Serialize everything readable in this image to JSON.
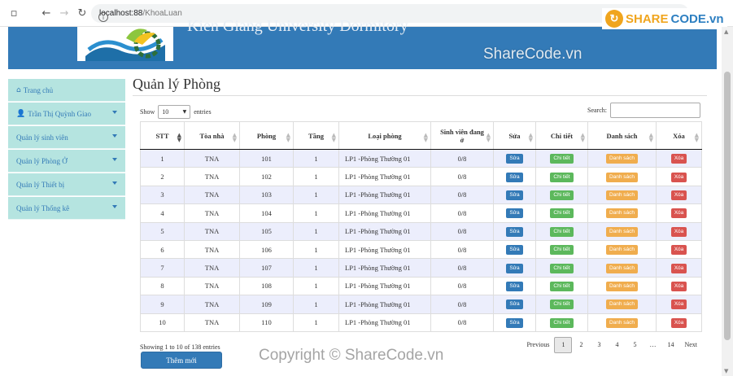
{
  "browser": {
    "url_host": "localhost:88",
    "url_path": "/KhoaLuan"
  },
  "header": {
    "title": "Kien Giang University Dormitory"
  },
  "watermarks": {
    "brand_share": "SHARE",
    "brand_code": "CODE.vn",
    "top": "ShareCode.vn",
    "bottom": "Copyright © ShareCode.vn"
  },
  "sidebar": {
    "items": [
      {
        "label": "Trang chủ",
        "icon": "home-icon",
        "has_caret": false
      },
      {
        "label": "Trần Thị Quỳnh Giao",
        "icon": "user-icon",
        "has_caret": true
      },
      {
        "label": "Quản lý sinh viên",
        "has_caret": true
      },
      {
        "label": "Quản lý Phòng Ở",
        "has_caret": true
      },
      {
        "label": "Quản lý Thiết bị",
        "has_caret": true
      },
      {
        "label": "Quản lý Thống kê",
        "has_caret": true
      }
    ]
  },
  "main": {
    "title": "Quản lý Phòng",
    "show_label": "Show",
    "entries_value": "10",
    "entries_label": "entries",
    "search_label": "Search:",
    "columns": [
      "STT",
      "Tòa nhà",
      "Phòng",
      "Tầng",
      "Loại phòng",
      "Sinh viên đang ở",
      "Sửa",
      "Chi tiết",
      "Danh sách",
      "Xóa"
    ],
    "rows": [
      {
        "stt": "1",
        "building": "TNA",
        "room": "101",
        "floor": "1",
        "type": "LP1 -Phòng Thường 01",
        "students": "0/8"
      },
      {
        "stt": "2",
        "building": "TNA",
        "room": "102",
        "floor": "1",
        "type": "LP1 -Phòng Thường 01",
        "students": "0/8"
      },
      {
        "stt": "3",
        "building": "TNA",
        "room": "103",
        "floor": "1",
        "type": "LP1 -Phòng Thường 01",
        "students": "0/8"
      },
      {
        "stt": "4",
        "building": "TNA",
        "room": "104",
        "floor": "1",
        "type": "LP1 -Phòng Thường 01",
        "students": "0/8"
      },
      {
        "stt": "5",
        "building": "TNA",
        "room": "105",
        "floor": "1",
        "type": "LP1 -Phòng Thường 01",
        "students": "0/8"
      },
      {
        "stt": "6",
        "building": "TNA",
        "room": "106",
        "floor": "1",
        "type": "LP1 -Phòng Thường 01",
        "students": "0/8"
      },
      {
        "stt": "7",
        "building": "TNA",
        "room": "107",
        "floor": "1",
        "type": "LP1 -Phòng Thường 01",
        "students": "0/8"
      },
      {
        "stt": "8",
        "building": "TNA",
        "room": "108",
        "floor": "1",
        "type": "LP1 -Phòng Thường 01",
        "students": "0/8"
      },
      {
        "stt": "9",
        "building": "TNA",
        "room": "109",
        "floor": "1",
        "type": "LP1 -Phòng Thường 01",
        "students": "0/8"
      },
      {
        "stt": "10",
        "building": "TNA",
        "room": "110",
        "floor": "1",
        "type": "LP1 -Phòng Thường 01",
        "students": "0/8"
      }
    ],
    "row_buttons": {
      "edit": "Sửa",
      "detail": "Chi tiết",
      "list": "Danh sách",
      "delete": "Xóa"
    },
    "info": "Showing 1 to 10 of 138 entries",
    "pagination": [
      "Previous",
      "1",
      "2",
      "3",
      "4",
      "5",
      "…",
      "14",
      "Next"
    ],
    "current_page": "1",
    "add_button": "Thêm mới"
  },
  "colors": {
    "banner": "#337ab7",
    "sidebar": "#b5e4e0",
    "edit_btn": "#337ab7",
    "detail_btn": "#5cb85c",
    "list_btn": "#f0ad4e",
    "delete_btn": "#d9534f",
    "odd_row": "#eceefc"
  }
}
